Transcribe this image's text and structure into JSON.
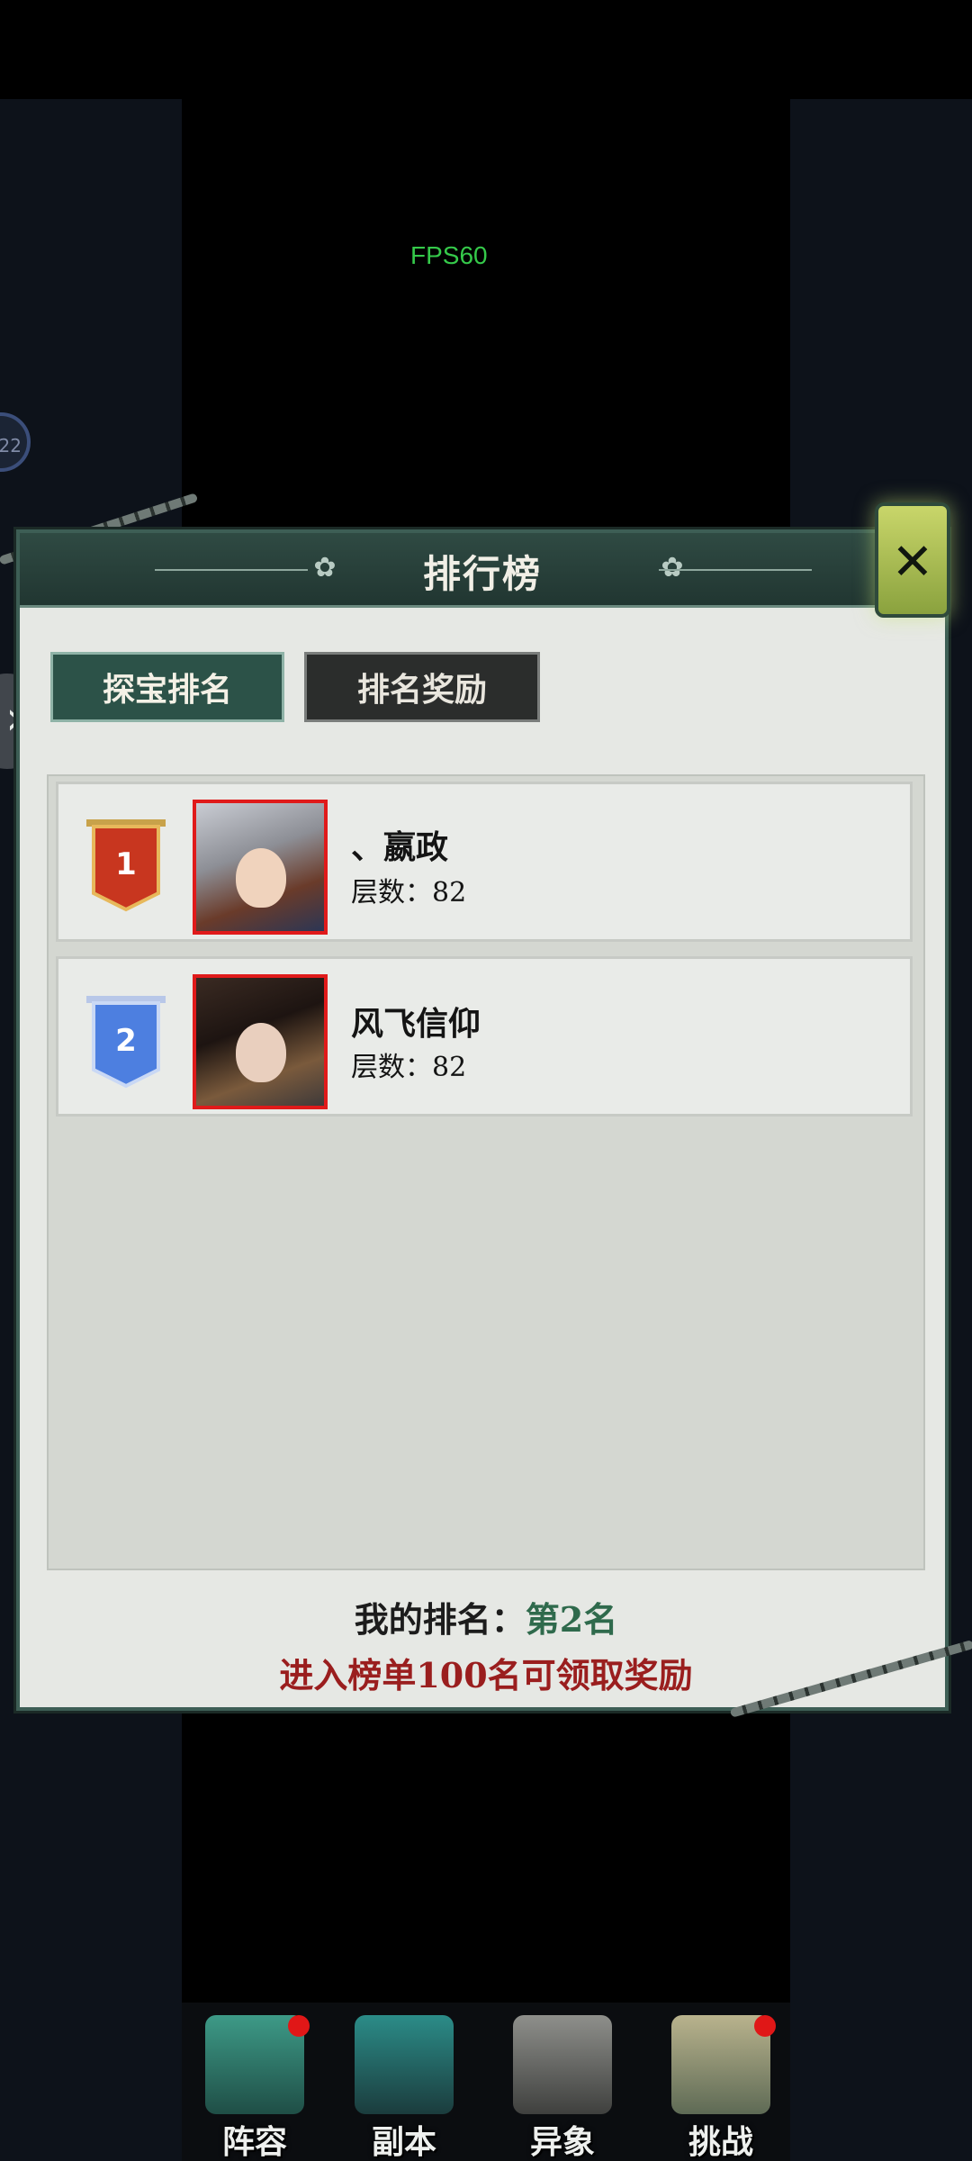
{
  "overlay": {
    "fps": "FPS60",
    "side_bubble_text": "22",
    "side_arrow_icon": "double-chevron-right-icon"
  },
  "modal": {
    "title": "排行榜",
    "close_icon": "close-icon",
    "tabs": [
      {
        "label": "探宝排名",
        "active": true
      },
      {
        "label": "排名奖励",
        "active": false
      }
    ],
    "rankings": [
      {
        "rank": "1",
        "badge_color": "#c8361f",
        "name": "、嬴政",
        "floors": "层数：82"
      },
      {
        "rank": "2",
        "badge_color": "#4d7fe0",
        "name": "风飞信仰",
        "floors": "层数：82"
      }
    ],
    "my_rank_label": "我的排名：",
    "my_rank_value": "第2名",
    "hint": "进入榜单100名可领取奖励"
  },
  "bottom_nav": [
    {
      "label": "阵容",
      "icon": "lineup-icon",
      "has_dot": true
    },
    {
      "label": "副本",
      "icon": "sword-icon",
      "has_dot": false
    },
    {
      "label": "异象",
      "icon": "crossed-swords-icon",
      "has_dot": false
    },
    {
      "label": "挑战",
      "icon": "scroll-icon",
      "has_dot": true
    }
  ]
}
